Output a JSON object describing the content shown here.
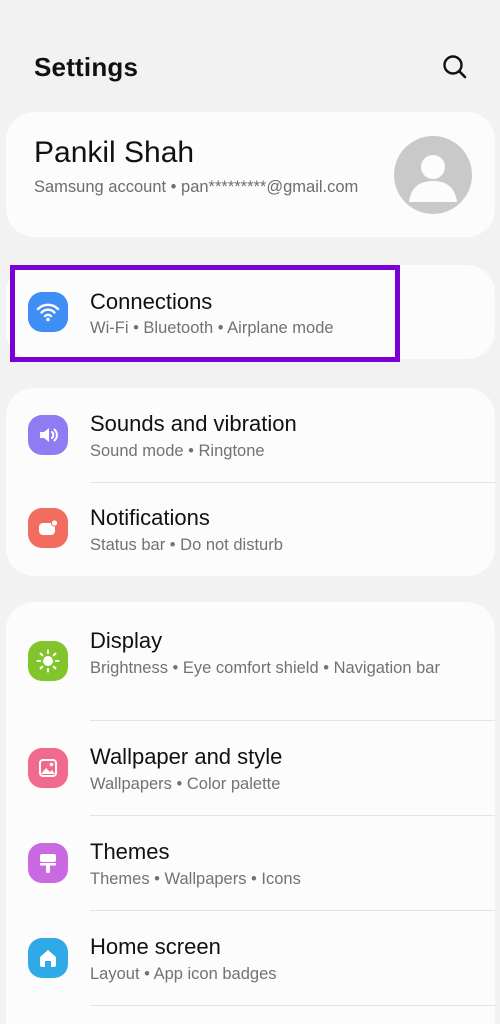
{
  "header": {
    "title": "Settings"
  },
  "profile": {
    "name": "Pankil Shah",
    "subtitle": "Samsung account  •  pan*********@gmail.com"
  },
  "connections": {
    "title": "Connections",
    "subtitle": "Wi-Fi  •  Bluetooth  •  Airplane mode"
  },
  "group1": [
    {
      "title": "Sounds and vibration",
      "subtitle": "Sound mode  •  Ringtone"
    },
    {
      "title": "Notifications",
      "subtitle": "Status bar  •  Do not disturb"
    }
  ],
  "group2": [
    {
      "title": "Display",
      "subtitle": "Brightness  •  Eye comfort shield  •  Navigation bar"
    },
    {
      "title": "Wallpaper and style",
      "subtitle": "Wallpapers  •  Color palette"
    },
    {
      "title": "Themes",
      "subtitle": "Themes  •  Wallpapers  •  Icons"
    },
    {
      "title": "Home screen",
      "subtitle": "Layout  •  App icon badges"
    }
  ],
  "colors": {
    "connections_icon": "#3f8ef5",
    "sounds_icon": "#8e7cf2",
    "notifications_icon": "#f26d5d",
    "display_icon": "#82c52a",
    "wallpaper_icon": "#f06a8e",
    "themes_icon": "#c96ae3",
    "home_icon": "#2fa9e8",
    "highlight": "#7a00d6"
  },
  "icons": {
    "search": "search-icon",
    "avatar": "person-icon",
    "connections": "wifi-icon",
    "sounds": "speaker-icon",
    "notifications": "notification-icon",
    "display": "sun-icon",
    "wallpaper": "image-icon",
    "themes": "brush-icon",
    "home": "home-icon"
  }
}
